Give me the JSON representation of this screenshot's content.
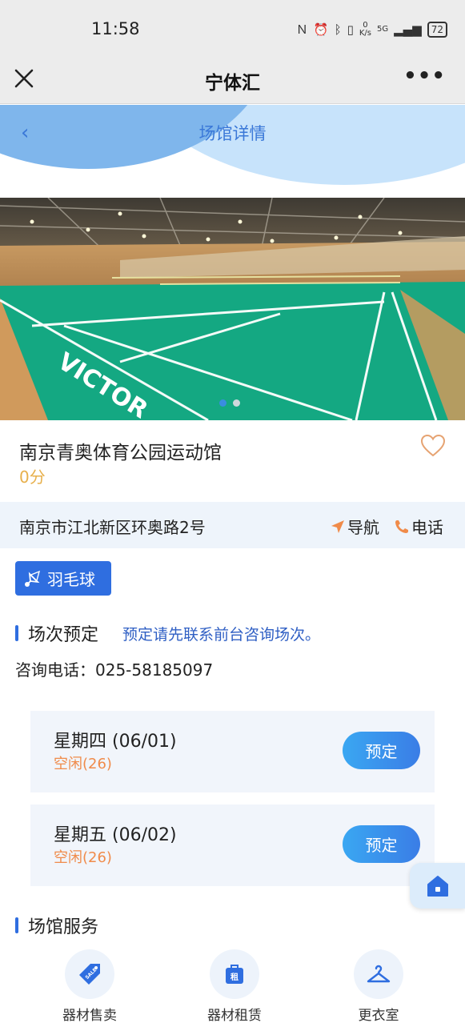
{
  "status_bar": {
    "time": "11:58",
    "net_speed_top": "0",
    "net_speed_bottom": "K/s",
    "signal": "5G",
    "battery": "72"
  },
  "app_bar": {
    "title": "宁体汇",
    "more": "•••"
  },
  "page": {
    "title": "场馆详情",
    "back": "‹"
  },
  "banner": {
    "slide_count": 2,
    "active_slide": 1,
    "court_brand": "VICTOR"
  },
  "venue": {
    "name": "南京青奥体育公园运动馆",
    "score": "0分",
    "favorited": false
  },
  "address": {
    "text": "南京市江北新区环奥路2号",
    "nav_label": "导航",
    "phone_label": "电话"
  },
  "sport_tag": {
    "label": "羽毛球"
  },
  "booking": {
    "section_title": "场次预定",
    "note": "预定请先联系前台咨询场次。",
    "consult_phone": "咨询电话：025-58185097",
    "days": [
      {
        "label": "星期四 (06/01)",
        "status": "空闲(26)",
        "button": "预定"
      },
      {
        "label": "星期五 (06/02)",
        "status": "空闲(26)",
        "button": "预定"
      }
    ]
  },
  "services": {
    "section_title": "场馆服务",
    "items": [
      {
        "label": "器材售卖",
        "icon": "sale-tag-icon"
      },
      {
        "label": "器材租赁",
        "icon": "rent-bag-icon"
      },
      {
        "label": "更衣室",
        "icon": "hanger-icon"
      }
    ]
  },
  "colors": {
    "primary": "#2f6ee0",
    "accent_orange": "#f08b4a",
    "score": "#e7b04c",
    "court_green": "#14a882"
  }
}
